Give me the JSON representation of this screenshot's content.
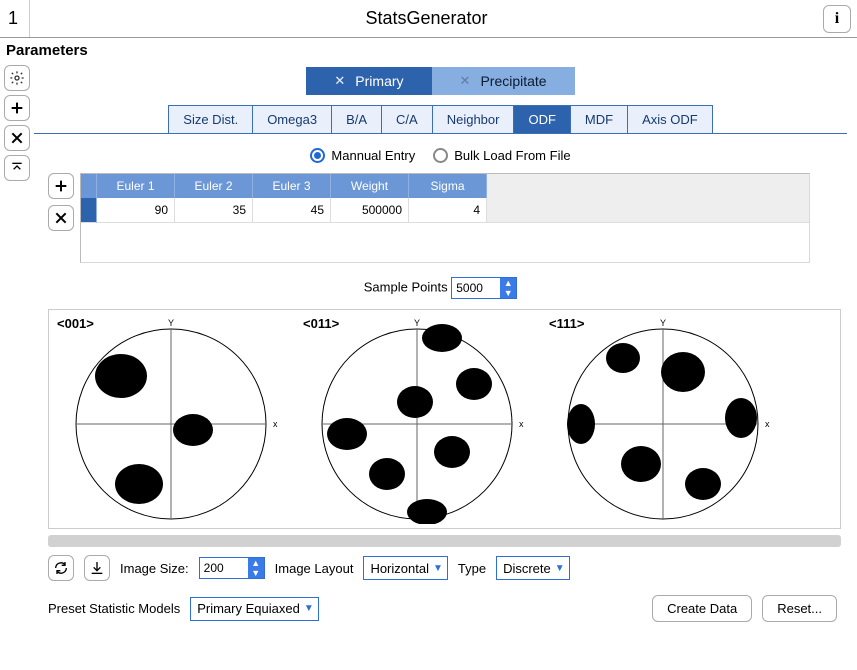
{
  "window": {
    "index": "1",
    "title": "StatsGenerator"
  },
  "section": {
    "parameters": "Parameters"
  },
  "tabs": {
    "primary": "Primary",
    "precipitate": "Precipitate",
    "mid": {
      "size_dist": "Size Dist.",
      "omega3": "Omega3",
      "ba": "B/A",
      "ca": "C/A",
      "neighbor": "Neighbor",
      "odf": "ODF",
      "mdf": "MDF",
      "axis_odf": "Axis ODF"
    }
  },
  "entry_mode": {
    "manual": "Mannual Entry",
    "bulk": "Bulk Load From File"
  },
  "table": {
    "headers": {
      "e1": "Euler 1",
      "e2": "Euler 2",
      "e3": "Euler 3",
      "w": "Weight",
      "s": "Sigma"
    },
    "row0": {
      "e1": "90",
      "e2": "35",
      "e3": "45",
      "w": "500000",
      "s": "4"
    }
  },
  "sample": {
    "label": "Sample Points",
    "value": "5000"
  },
  "plots": {
    "p001": "<001>",
    "p011": "<011>",
    "p111": "<111>"
  },
  "controls": {
    "image_size_label": "Image Size:",
    "image_size_value": "200",
    "image_layout_label": "Image Layout",
    "image_layout_value": "Horizontal",
    "type_label": "Type",
    "type_value": "Discrete"
  },
  "footer": {
    "preset_label": "Preset Statistic Models",
    "preset_value": "Primary Equiaxed",
    "create": "Create Data",
    "reset": "Reset..."
  }
}
